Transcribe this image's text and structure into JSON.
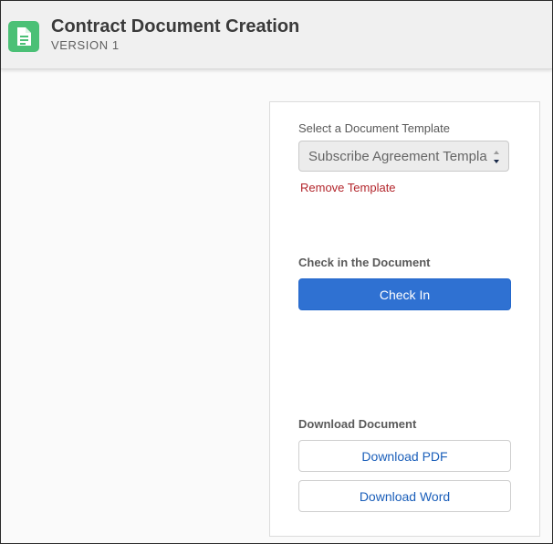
{
  "header": {
    "title": "Contract Document Creation",
    "subtitle": "VERSION 1",
    "icon": "document-icon",
    "icon_color": "#4bc076"
  },
  "template_section": {
    "label": "Select a Document Template",
    "selected_value": "Subscribe Agreement Template",
    "remove_link": "Remove Template"
  },
  "checkin_section": {
    "label": "Check in the Document",
    "button": "Check In",
    "button_color": "#2f71d2"
  },
  "download_section": {
    "label": "Download Document",
    "pdf_button": "Download PDF",
    "word_button": "Download Word"
  },
  "colors": {
    "link_red": "#b3262c",
    "link_blue": "#1b5fba"
  }
}
